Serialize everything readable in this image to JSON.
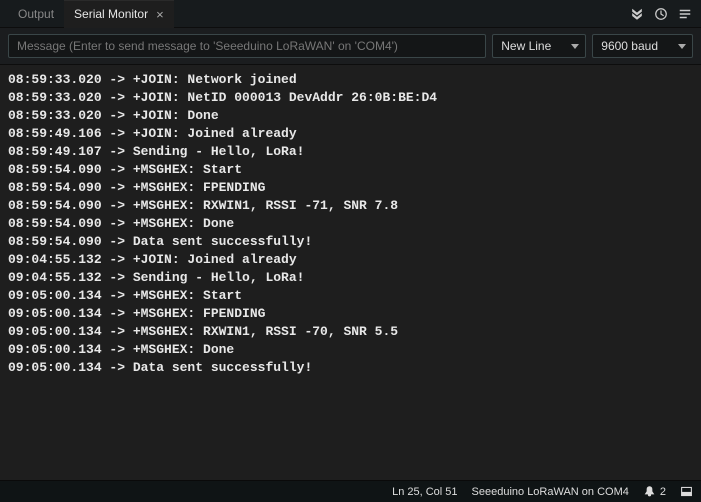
{
  "tabs": {
    "output": "Output",
    "serial_monitor": "Serial Monitor"
  },
  "controls": {
    "input_placeholder": "Message (Enter to send message to 'Seeeduino LoRaWAN' on 'COM4')",
    "line_ending": "New Line",
    "baud": "9600 baud"
  },
  "log_lines": [
    "08:59:33.020 -> +JOIN: Network joined",
    "08:59:33.020 -> +JOIN: NetID 000013 DevAddr 26:0B:BE:D4",
    "08:59:33.020 -> +JOIN: Done",
    "08:59:49.106 -> +JOIN: Joined already",
    "08:59:49.107 -> Sending - Hello, LoRa!",
    "08:59:54.090 -> +MSGHEX: Start",
    "08:59:54.090 -> +MSGHEX: FPENDING",
    "08:59:54.090 -> +MSGHEX: RXWIN1, RSSI -71, SNR 7.8",
    "08:59:54.090 -> +MSGHEX: Done",
    "08:59:54.090 -> Data sent successfully!",
    "09:04:55.132 -> +JOIN: Joined already",
    "09:04:55.132 -> Sending - Hello, LoRa!",
    "09:05:00.134 -> +MSGHEX: Start",
    "09:05:00.134 -> +MSGHEX: FPENDING",
    "09:05:00.134 -> +MSGHEX: RXWIN1, RSSI -70, SNR 5.5",
    "09:05:00.134 -> +MSGHEX: Done",
    "09:05:00.134 -> Data sent successfully!"
  ],
  "status": {
    "cursor": "Ln 25, Col 51",
    "board": "Seeeduino LoRaWAN on COM4",
    "notifications_count": "2"
  }
}
